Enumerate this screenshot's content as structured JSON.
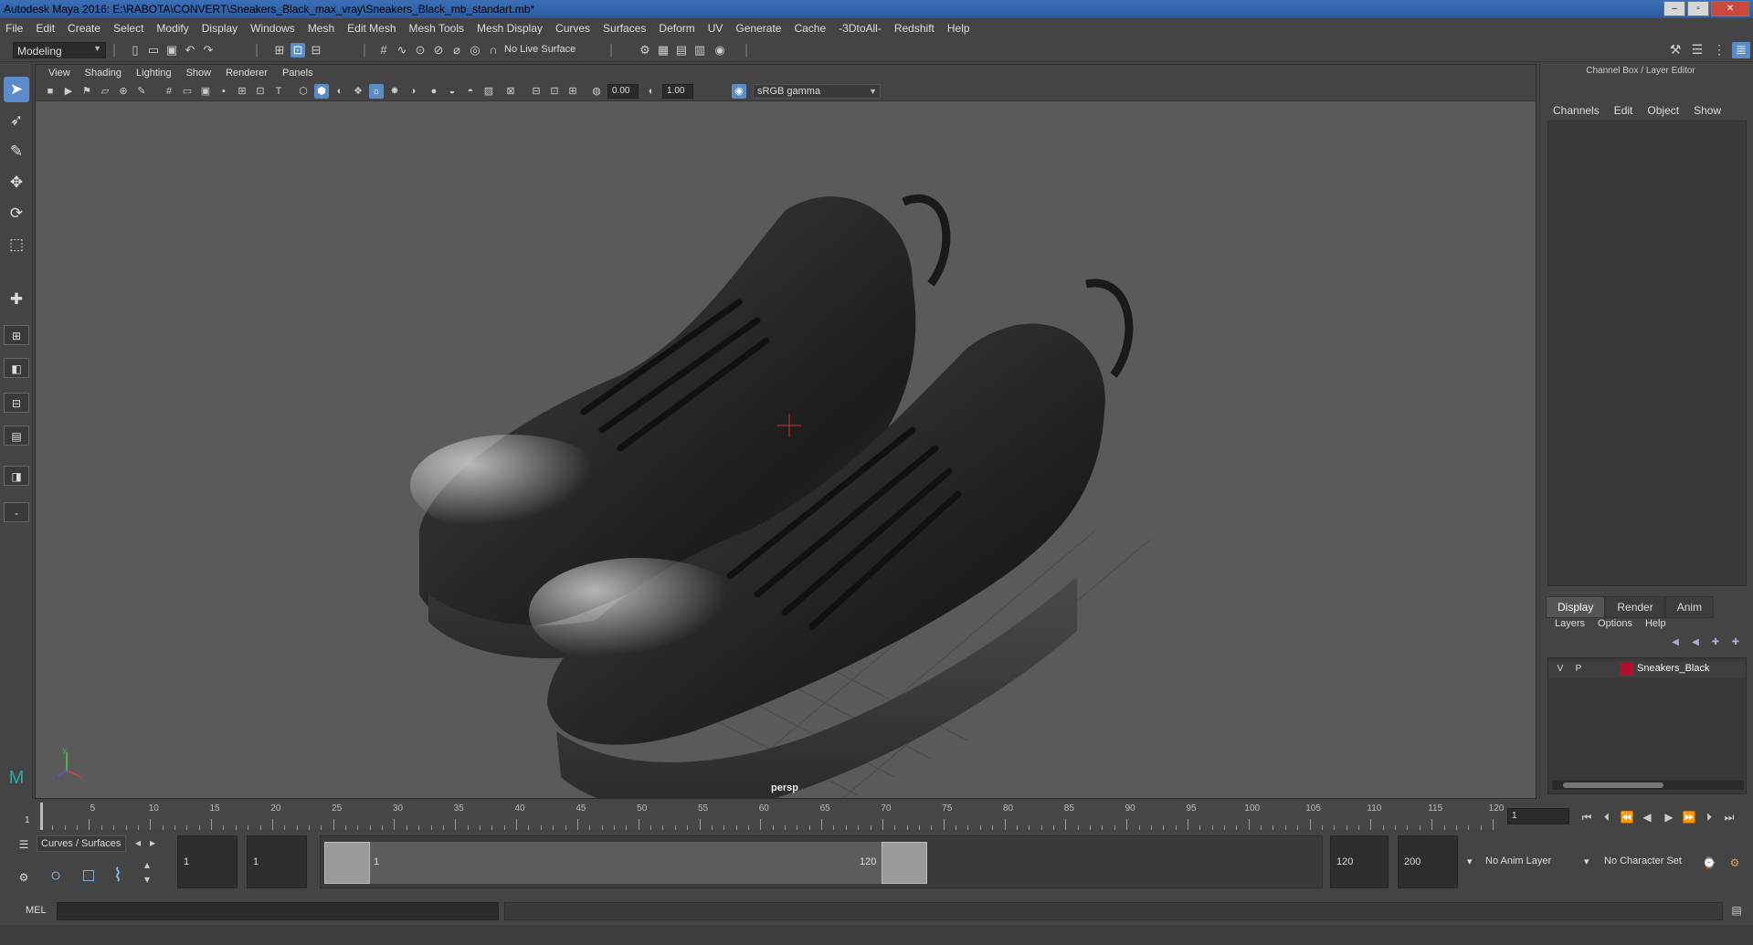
{
  "window": {
    "title": "Autodesk Maya 2016: E:\\RABOTA\\CONVERT\\Sneakers_Black_max_vray\\Sneakers_Black_mb_standart.mb*"
  },
  "menus": [
    "File",
    "Edit",
    "Create",
    "Select",
    "Modify",
    "Display",
    "Windows",
    "Mesh",
    "Edit Mesh",
    "Mesh Tools",
    "Mesh Display",
    "Curves",
    "Surfaces",
    "Deform",
    "UV",
    "Generate",
    "Cache",
    "-3DtoAll-",
    "Redshift",
    "Help"
  ],
  "statusline": {
    "mode": "Modeling",
    "live_surface": "No Live Surface"
  },
  "viewport": {
    "menus": [
      "View",
      "Shading",
      "Lighting",
      "Show",
      "Renderer",
      "Panels"
    ],
    "exposure": "0.00",
    "gamma": "1.00",
    "color_space": "sRGB gamma",
    "camera": "persp",
    "axis": {
      "x": "x",
      "y": "y",
      "z": "z"
    }
  },
  "channelbox": {
    "title": "Channel Box / Layer Editor",
    "tabs": [
      "Channels",
      "Edit",
      "Object",
      "Show"
    ],
    "layer_tabs": [
      "Display",
      "Render",
      "Anim"
    ],
    "layer_menu": [
      "Layers",
      "Options",
      "Help"
    ],
    "layers": [
      {
        "v": "V",
        "p": "P",
        "name": "Sneakers_Black",
        "color": "#b0102a"
      }
    ]
  },
  "timeslider": {
    "ticks": [
      "5",
      "10",
      "15",
      "20",
      "25",
      "30",
      "35",
      "40",
      "45",
      "50",
      "55",
      "60",
      "65",
      "70",
      "75",
      "80",
      "85",
      "90",
      "95",
      "100",
      "105",
      "110",
      "115",
      "120"
    ],
    "current_marker": "1",
    "current_frame": "1"
  },
  "range": {
    "shelf_tab": "Curves / Surfaces",
    "start": "1",
    "playback_start": "1",
    "range_start_label": "1",
    "range_end_label": "120",
    "playback_end": "120",
    "end": "200",
    "anim_layer": "No Anim Layer",
    "character_set": "No Character Set"
  },
  "cmdline": {
    "label": "MEL"
  }
}
